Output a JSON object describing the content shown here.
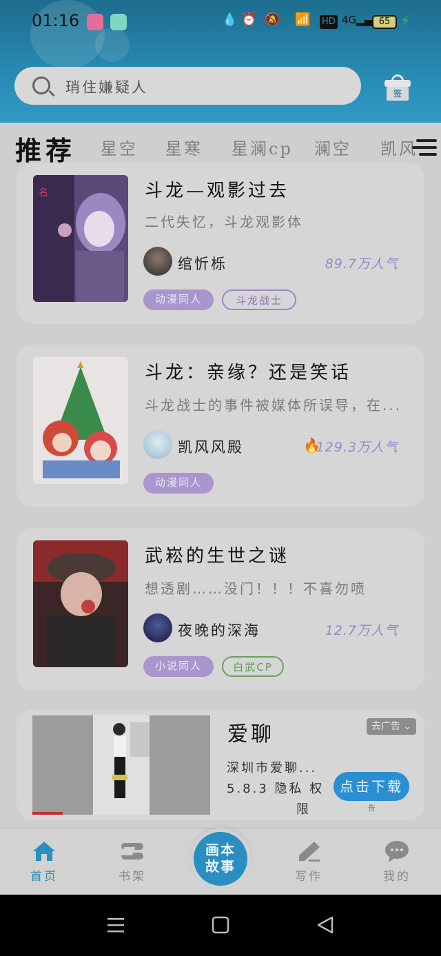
{
  "status_bar": {
    "time": "01:16",
    "battery": "65"
  },
  "search": {
    "placeholder": "琑住嫌疑人"
  },
  "gift": {
    "badge": "签"
  },
  "tabs": [
    {
      "label": "推荐",
      "active": true
    },
    {
      "label": "星空",
      "active": false
    },
    {
      "label": "星寒",
      "active": false
    },
    {
      "label": "星澜cp",
      "active": false
    },
    {
      "label": "澜空",
      "active": false
    },
    {
      "label": "凯风",
      "active": false
    }
  ],
  "cards": [
    {
      "title": "斗龙—观影过去",
      "desc": "二代失忆，斗龙观影体",
      "author": "绾忻栎",
      "popularity": "89.7万人气",
      "tags": [
        "动漫同人",
        "斗龙战士"
      ]
    },
    {
      "title": "斗龙：亲缘？还是笑话",
      "desc": "斗龙战士的事件被媒体所误导，在...",
      "author": "凯风风殿",
      "popularity": "129.3万人气",
      "tags": [
        "动漫同人"
      ]
    },
    {
      "title": "武崧的生世之谜",
      "desc": "想透剧……没门！！！不喜勿喷",
      "author": "夜晚的深海",
      "popularity": "12.7万人气",
      "tags": [
        "小说同人",
        "白武CP"
      ]
    }
  ],
  "ad": {
    "title": "爱聊",
    "close_label": "去广告",
    "line1": "深圳市爱聊...",
    "line2": "5.8.3 隐私 权",
    "line3": "限",
    "button": "点击下载",
    "note": "告"
  },
  "bottom_nav": {
    "home": "首页",
    "shelf": "书架",
    "center_line1": "画本",
    "center_line2": "故事",
    "write": "写作",
    "mine": "我的"
  },
  "colors": {
    "accent": "#2a8fb8",
    "tag_purple": "#a896cc",
    "tag_green": "#6ca05c"
  }
}
